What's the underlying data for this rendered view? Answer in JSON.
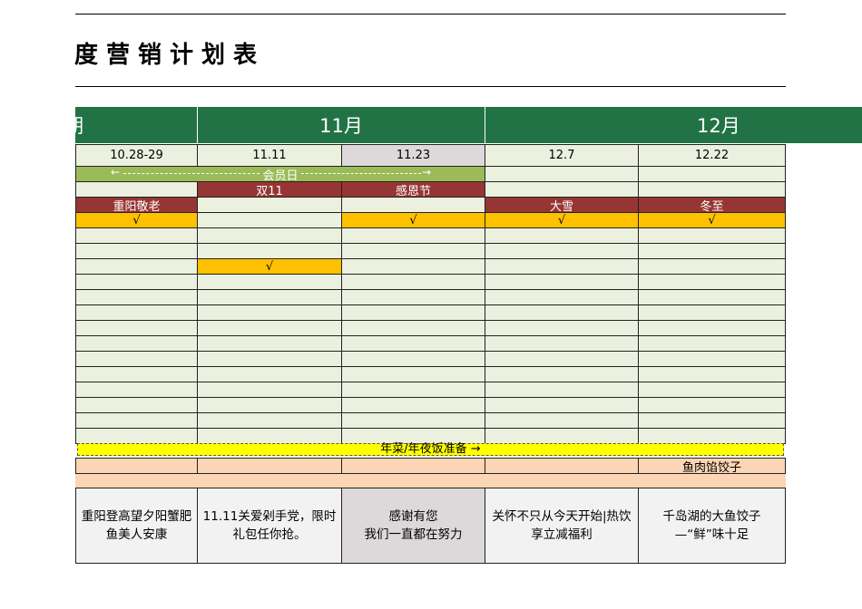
{
  "title": "度营销计划表",
  "months": [
    {
      "label": "期",
      "cols": [
        0
      ]
    },
    {
      "label": "11月",
      "cols": [
        1,
        2
      ]
    },
    {
      "label": "12月",
      "cols": [
        3,
        4
      ]
    }
  ],
  "dates": [
    "10.28-29",
    "11.11",
    "11.23",
    "12.7",
    "12.22"
  ],
  "member_day": {
    "label": "会员日",
    "left_arrow": "←",
    "right_arrow": "→"
  },
  "festival_row_a": [
    "",
    "双11",
    "感恩节",
    "",
    ""
  ],
  "festival_row_b": [
    "重阳敬老",
    "",
    "",
    "大雪",
    "冬至"
  ],
  "check_row_main": [
    "√",
    "",
    "√",
    "√",
    "√"
  ],
  "check_row_secondary": [
    "",
    "√",
    "",
    "",
    ""
  ],
  "banner": {
    "text": "年菜/年夜饭准备 →"
  },
  "peach_row": [
    "",
    "",
    "",
    "",
    "鱼肉馅饺子"
  ],
  "summaries": [
    "重阳登高望夕阳蟹肥鱼美人安康",
    "11.11关爱剁手党，限时礼包任你抢。",
    "感谢有您\n我们一直都在努力",
    "关怀不只从今天开始|热饮享立减福利",
    "千岛湖的大鱼饺子—“鲜”味十足"
  ],
  "colors": {
    "green": "#217346",
    "light_green": "#ebf1de",
    "member_bar": "#9bbb59",
    "red": "#963634",
    "orange": "#ffc000",
    "yellow": "#ffff00",
    "peach": "#fcd5b4",
    "gray": "#ddd9da"
  }
}
